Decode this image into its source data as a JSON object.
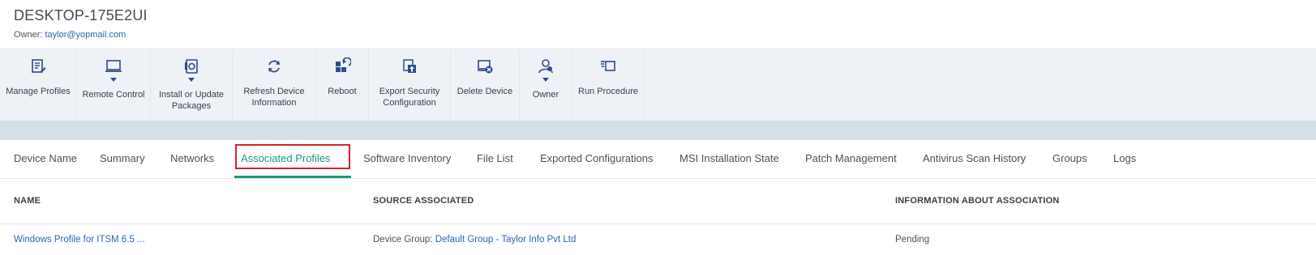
{
  "device": {
    "title": "DESKTOP-175E2UI",
    "owner_label": "Owner:",
    "owner_email": "taylor@yopmail.com"
  },
  "toolbar": {
    "manage_profiles": "Manage Profiles",
    "remote_control": "Remote Control",
    "install_update_line1": "Install or Update",
    "install_update_line2": "Packages",
    "refresh_line1": "Refresh Device",
    "refresh_line2": "Information",
    "reboot": "Reboot",
    "export_line1": "Export Security",
    "export_line2": "Configuration",
    "delete_device": "Delete Device",
    "owner": "Owner",
    "run_procedure": "Run Procedure"
  },
  "tabs": {
    "device_name": "Device Name",
    "summary": "Summary",
    "networks": "Networks",
    "associated_profiles": "Associated Profiles",
    "software_inventory": "Software Inventory",
    "file_list": "File List",
    "exported_configurations": "Exported Configurations",
    "msi_installation_state": "MSI Installation State",
    "patch_management": "Patch Management",
    "antivirus_scan_history": "Antivirus Scan History",
    "groups": "Groups",
    "logs": "Logs"
  },
  "table": {
    "columns": [
      "NAME",
      "SOURCE ASSOCIATED",
      "INFORMATION ABOUT ASSOCIATION"
    ],
    "rows": [
      {
        "name": "Windows Profile for ITSM 6.5 ...",
        "source_prefix": "Device Group:",
        "source_link": "Default Group - Taylor Info Pvt Ltd",
        "info": "Pending"
      }
    ]
  },
  "colors": {
    "accent_green": "#1b9a7a",
    "link_blue": "#2b64b5",
    "highlight_red": "#d9232e",
    "icon_blue": "#2c4e86"
  }
}
